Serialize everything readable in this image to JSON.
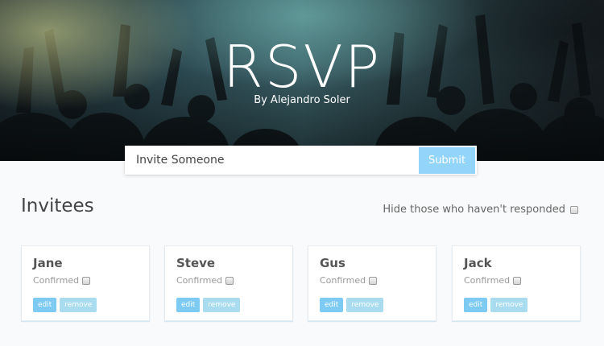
{
  "header": {
    "title": "RSVP",
    "subtitle": "By Alejandro Soler"
  },
  "invite_form": {
    "placeholder": "Invite Someone",
    "submit_label": "Submit"
  },
  "main": {
    "section_title": "Invitees",
    "filter_label": "Hide those who haven't responded",
    "filter_checked": false
  },
  "invitees": [
    {
      "name": "Jane",
      "status_label": "Confirmed",
      "confirmed": false,
      "edit_label": "edit",
      "remove_label": "remove"
    },
    {
      "name": "Steve",
      "status_label": "Confirmed",
      "confirmed": false,
      "edit_label": "edit",
      "remove_label": "remove"
    },
    {
      "name": "Gus",
      "status_label": "Confirmed",
      "confirmed": false,
      "edit_label": "edit",
      "remove_label": "remove"
    },
    {
      "name": "Jack",
      "status_label": "Confirmed",
      "confirmed": false,
      "edit_label": "edit",
      "remove_label": "remove"
    }
  ],
  "colors": {
    "submit_button": "#93d4fa",
    "edit_button": "#7dcaf3",
    "remove_button": "#a9dcef"
  }
}
